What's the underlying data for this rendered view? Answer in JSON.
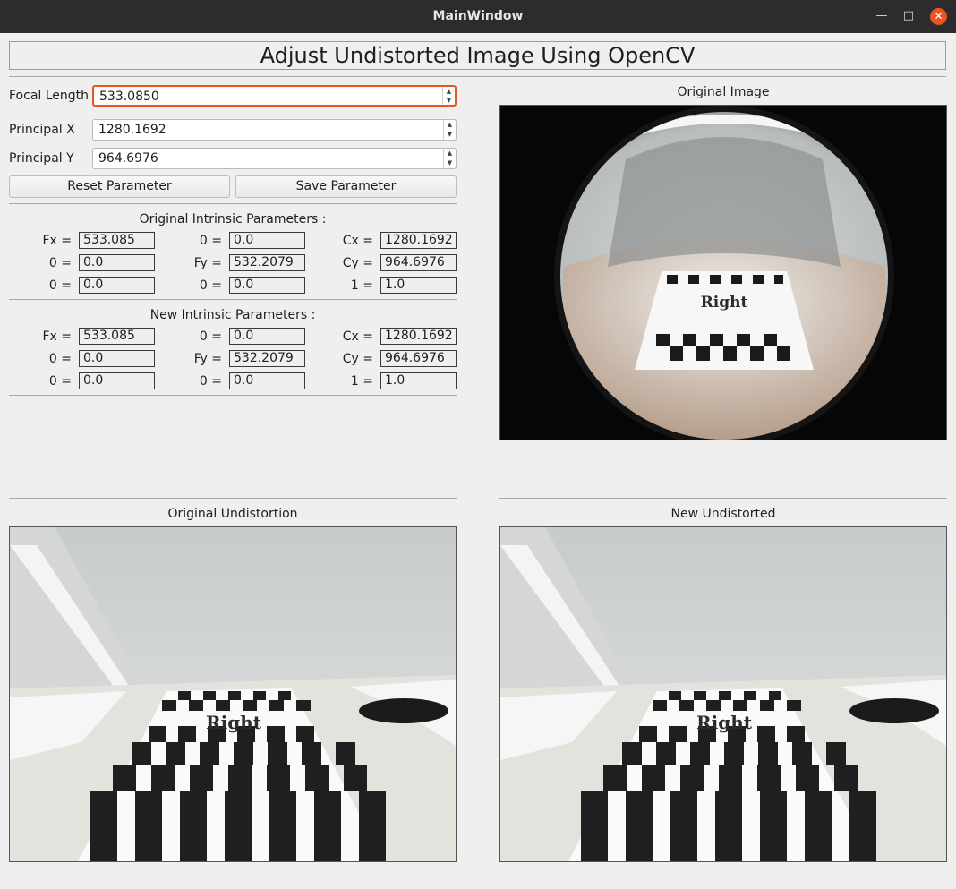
{
  "window": {
    "title": "MainWindow",
    "min_icon": "minimize-icon",
    "max_icon": "maximize-icon",
    "close_icon": "close-icon",
    "accent": "#e95420"
  },
  "header": {
    "title": "Adjust Undistorted Image Using OpenCV"
  },
  "controls": {
    "focal_length": {
      "label": "Focal Length",
      "value": "533.0850"
    },
    "principal_x": {
      "label": "Principal X",
      "value": "1280.1692"
    },
    "principal_y": {
      "label": "Principal Y",
      "value": "964.6976"
    },
    "reset_button": "Reset Parameter",
    "save_button": "Save Parameter"
  },
  "original_intrinsic": {
    "title": "Original Intrinsic Parameters :",
    "rows": [
      [
        {
          "label": "Fx =",
          "value": "533.085"
        },
        {
          "label": "0 =",
          "value": "0.0"
        },
        {
          "label": "Cx =",
          "value": "1280.1692"
        }
      ],
      [
        {
          "label": "0 =",
          "value": "0.0"
        },
        {
          "label": "Fy =",
          "value": "532.2079"
        },
        {
          "label": "Cy =",
          "value": "964.6976"
        }
      ],
      [
        {
          "label": "0 =",
          "value": "0.0"
        },
        {
          "label": "0 =",
          "value": "0.0"
        },
        {
          "label": "1 =",
          "value": "1.0"
        }
      ]
    ]
  },
  "new_intrinsic": {
    "title": "New Intrinsic Parameters :",
    "rows": [
      [
        {
          "label": "Fx =",
          "value": "533.085"
        },
        {
          "label": "0 =",
          "value": "0.0"
        },
        {
          "label": "Cx =",
          "value": "1280.1692"
        }
      ],
      [
        {
          "label": "0 =",
          "value": "0.0"
        },
        {
          "label": "Fy =",
          "value": "532.2079"
        },
        {
          "label": "Cy =",
          "value": "964.6976"
        }
      ],
      [
        {
          "label": "0 =",
          "value": "0.0"
        },
        {
          "label": "0 =",
          "value": "0.0"
        },
        {
          "label": "1 =",
          "value": "1.0"
        }
      ]
    ]
  },
  "images": {
    "original_image": {
      "title": "Original Image",
      "board_text": "Right"
    },
    "original_undistortion": {
      "title": "Original Undistortion",
      "board_text": "Right"
    },
    "new_undistorted": {
      "title": "New Undistorted",
      "board_text": "Right"
    }
  }
}
